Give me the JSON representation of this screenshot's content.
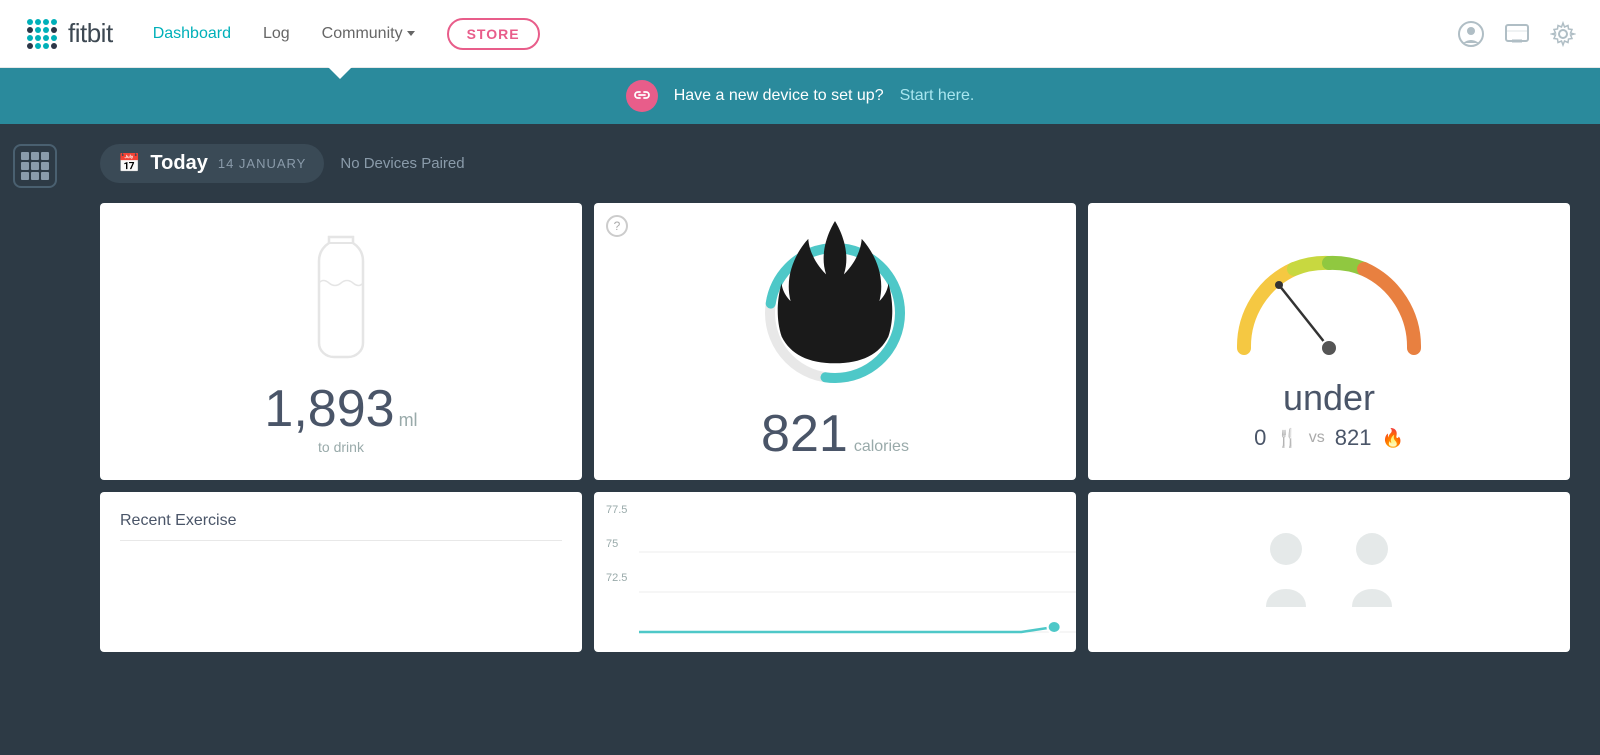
{
  "topnav": {
    "logo_text": "fitbit",
    "nav_dashboard": "Dashboard",
    "nav_log": "Log",
    "nav_community": "Community",
    "nav_store": "STORE",
    "icon_profile": "👤",
    "icon_messages": "💬",
    "icon_settings": "⚙"
  },
  "banner": {
    "text": "Have a new device to set up?",
    "link_text": "Start here.",
    "icon": "🔗"
  },
  "date_bar": {
    "today_label": "Today",
    "date_sub": "14 JANUARY",
    "no_devices": "No Devices Paired"
  },
  "water_card": {
    "value": "1,893",
    "unit": "ml",
    "label": "to drink"
  },
  "calories_card": {
    "value": "821",
    "unit": "calories",
    "question": "?"
  },
  "gauge_card": {
    "label": "under",
    "food_value": "0",
    "vs_text": "vs",
    "burned_value": "821"
  },
  "recent_exercise": {
    "title": "Recent Exercise"
  },
  "chart": {
    "y_labels": [
      "77.5",
      "75",
      "72.5"
    ]
  }
}
